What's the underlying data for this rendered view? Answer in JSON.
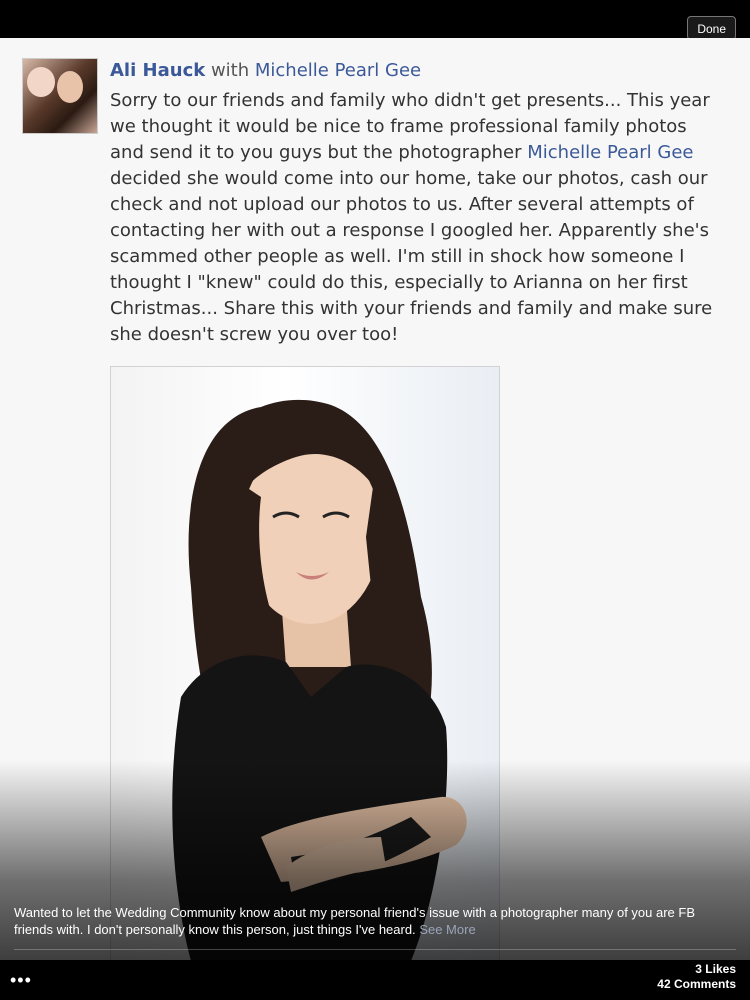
{
  "toolbar": {
    "done_label": "Done"
  },
  "post": {
    "author": "Ali Hauck",
    "with_word": "with",
    "tagged": "Michelle Pearl Gee",
    "text_part1": "Sorry to our friends and family who didn't get presents... This year we thought it would be nice to frame professional family photos and send it to you guys but the photographer ",
    "mention": "Michelle Pearl Gee",
    "text_part2": " decided she would come into our home, take our photos, cash our check and not upload our photos to us. After several attempts of contacting her with out a response I googled her. Apparently she's scammed other people as well. I'm still in shock how someone I thought I \"knew\" could do this, especially to Arianna on her first Christmas... Share this with your friends and family and make sure she doesn't screw you over too!"
  },
  "caption": {
    "text": "Wanted to let the Wedding Community know about my personal friend's issue with a photographer many of you are FB friends with. I don't personally know this person, just things I've heard.",
    "see_more": "See More"
  },
  "footer": {
    "more_icon": "•••",
    "likes": "3 Likes",
    "comments": "42 Comments"
  },
  "colors": {
    "link": "#3b5998",
    "text": "#333333",
    "background": "#f7f7f7",
    "bar": "#000000"
  },
  "icons": [
    "ellipsis-icon"
  ]
}
